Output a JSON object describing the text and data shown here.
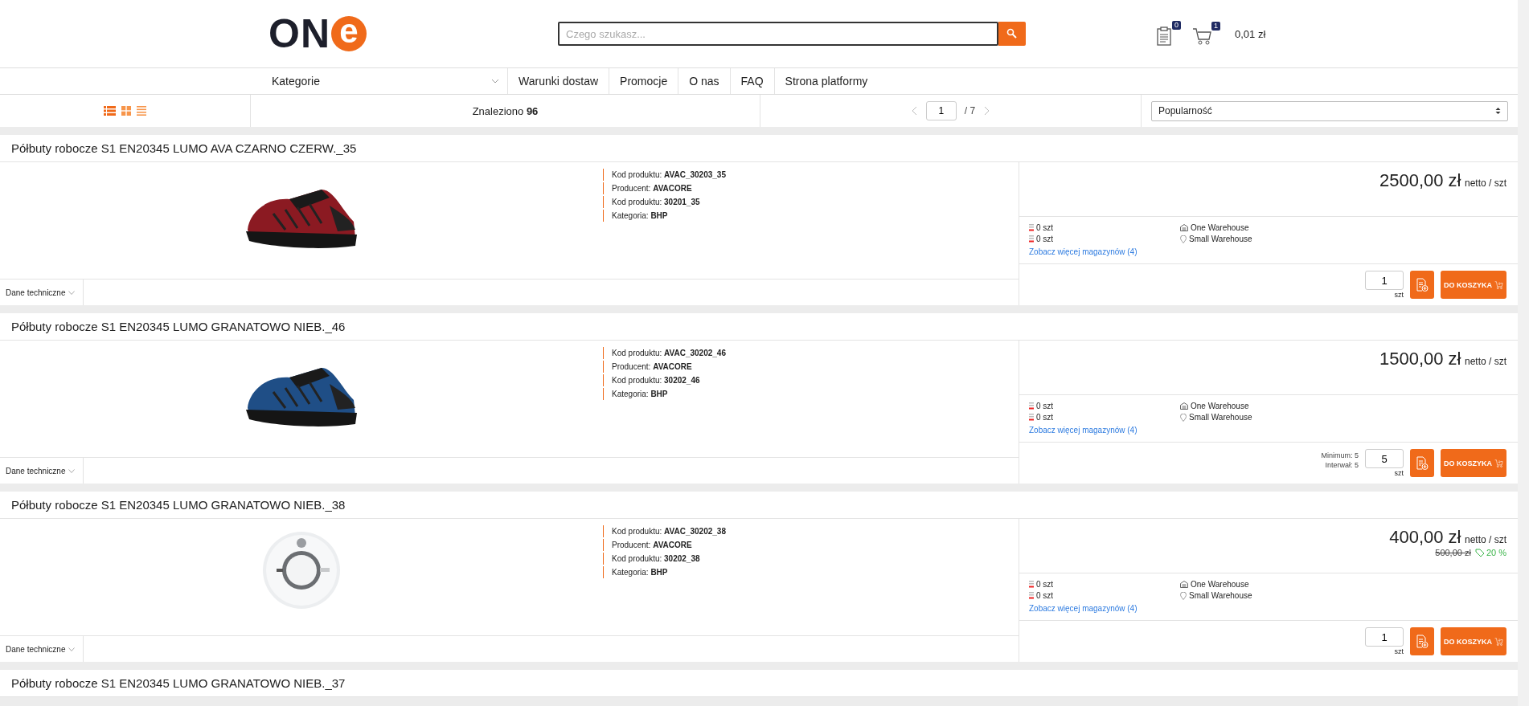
{
  "logo": {
    "text": "ON",
    "accent": "e"
  },
  "search": {
    "placeholder": "Czego szukasz..."
  },
  "header": {
    "quotes_count": "0",
    "cart_count": "1",
    "cart_total": "0,01 zł"
  },
  "nav": {
    "categories": "Kategorie",
    "links": [
      "Warunki dostaw",
      "Promocje",
      "O nas",
      "FAQ",
      "Strona platformy"
    ]
  },
  "toolbar": {
    "found_label": "Znaleziono",
    "found_count": "96",
    "page": "1",
    "pages": "/ 7",
    "sort": "Popularność"
  },
  "products": [
    {
      "title": "Półbuty robocze S1 EN20345 LUMO AVA CZARNO CZERW._35",
      "image": {
        "kind": "picture"
      },
      "details": [
        {
          "label": "Kod produktu:",
          "value": "AVAC_30203_35"
        },
        {
          "label": "Producent:",
          "value": "AVACORE"
        },
        {
          "label": "Kod produktu:",
          "value": "30201_35"
        },
        {
          "label": "Kategoria:",
          "value": "BHP"
        }
      ],
      "price": "2500,00 zł",
      "price_unit": "netto / szt",
      "stock": [
        {
          "qty": "0 szt",
          "warehouse": "One Warehouse",
          "kind": "building"
        },
        {
          "qty": "0 szt",
          "warehouse": "Small Warehouse",
          "kind": "pin"
        }
      ],
      "more_link": "Zobacz więcej magazynów (4)",
      "quantity": "1",
      "qty_unit": "szt",
      "cart_button": "DO KOSZYKA",
      "tech_label": "Dane techniczne"
    },
    {
      "title": "Półbuty robocze S1 EN20345 LUMO GRANATOWO NIEB._46",
      "image": {
        "kind": "picture"
      },
      "details": [
        {
          "label": "Kod produktu:",
          "value": "AVAC_30202_46"
        },
        {
          "label": "Producent:",
          "value": "AVACORE"
        },
        {
          "label": "Kod produktu:",
          "value": "30202_46"
        },
        {
          "label": "Kategoria:",
          "value": "BHP"
        }
      ],
      "price": "1500,00 zł",
      "price_unit": "netto / szt",
      "stock": [
        {
          "qty": "0 szt",
          "warehouse": "One Warehouse",
          "kind": "building"
        },
        {
          "qty": "0 szt",
          "warehouse": "Small Warehouse",
          "kind": "pin"
        }
      ],
      "more_link": "Zobacz więcej magazynów (4)",
      "min_info": [
        "Minimum: 5",
        "Interwał: 5"
      ],
      "quantity": "5",
      "qty_unit": "szt",
      "cart_button": "DO KOSZYKA",
      "tech_label": "Dane techniczne"
    },
    {
      "title": "Półbuty robocze S1 EN20345 LUMO GRANATOWO NIEB._38",
      "image": {
        "kind": "picture"
      },
      "details": [
        {
          "label": "Kod produktu:",
          "value": "AVAC_30202_38"
        },
        {
          "label": "Producent:",
          "value": "AVACORE"
        },
        {
          "label": "Kod produktu:",
          "value": "30202_38"
        },
        {
          "label": "Kategoria:",
          "value": "BHP"
        }
      ],
      "price": "400,00 zł",
      "price_unit": "netto / szt",
      "old_price": "500,00 zł",
      "discount": "20 %",
      "stock": [
        {
          "qty": "0 szt",
          "warehouse": "One Warehouse",
          "kind": "building"
        },
        {
          "qty": "0 szt",
          "warehouse": "Small Warehouse",
          "kind": "pin"
        }
      ],
      "more_link": "Zobacz więcej magazynów (4)",
      "quantity": "1",
      "qty_unit": "szt",
      "cart_button": "DO KOSZYKA",
      "tech_label": "Dane techniczne"
    },
    {
      "title": "Półbuty robocze S1 EN20345 LUMO GRANATOWO NIEB._37"
    }
  ]
}
